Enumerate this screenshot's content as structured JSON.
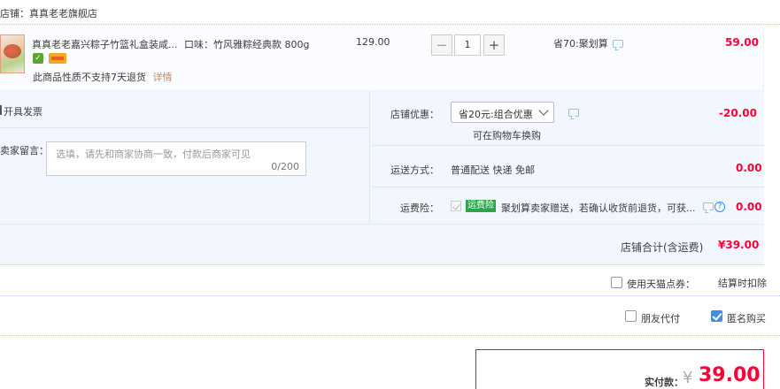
{
  "store": {
    "name": "店铺：真真老老旗舰店"
  },
  "item": {
    "title": "真真老老嘉兴粽子竹篮礼盒装咸...",
    "spec": "口味：竹风雅粽经典款 800g",
    "return_note": "此商品性质不支持7天退货",
    "detail_link": "详情",
    "unit_price": "129.00",
    "quantity": "1",
    "minus": "−",
    "plus": "+",
    "promo": "省70:聚划算",
    "subtotal": "59.00"
  },
  "invoice": {
    "label": "开具发票"
  },
  "message": {
    "label": "卖家留言：",
    "placeholder": "选填，请先和商家协商一致，付款后商家可见",
    "counter": "0/200"
  },
  "discount": {
    "label": "店铺优惠：",
    "selected": "省20元:组合优惠",
    "note": "可在购物车换购",
    "amount": "-20.00"
  },
  "shipping": {
    "label": "运送方式：",
    "value": "普通配送 快递 免邮",
    "amount": "0.00"
  },
  "insurance": {
    "label": "运费险：",
    "tag": "运费险",
    "text": "聚划算卖家赠送，若确认收货前退货，可获...",
    "help": "?",
    "amount": "0.00"
  },
  "store_total": {
    "label": "店铺合计(含运费)",
    "amount": "¥39.00"
  },
  "points": {
    "label": "使用天猫点券：",
    "note": "结算时扣除"
  },
  "friend_pay": {
    "label": "朋友代付"
  },
  "anonymous": {
    "label": "匿名购买",
    "checked": true
  },
  "payment": {
    "label": "实付款：",
    "currency": "¥",
    "amount": "39.00"
  },
  "colors": {
    "accent": "#ff0036",
    "panel": "#f2f7ff",
    "link": "#3d8fe6"
  }
}
